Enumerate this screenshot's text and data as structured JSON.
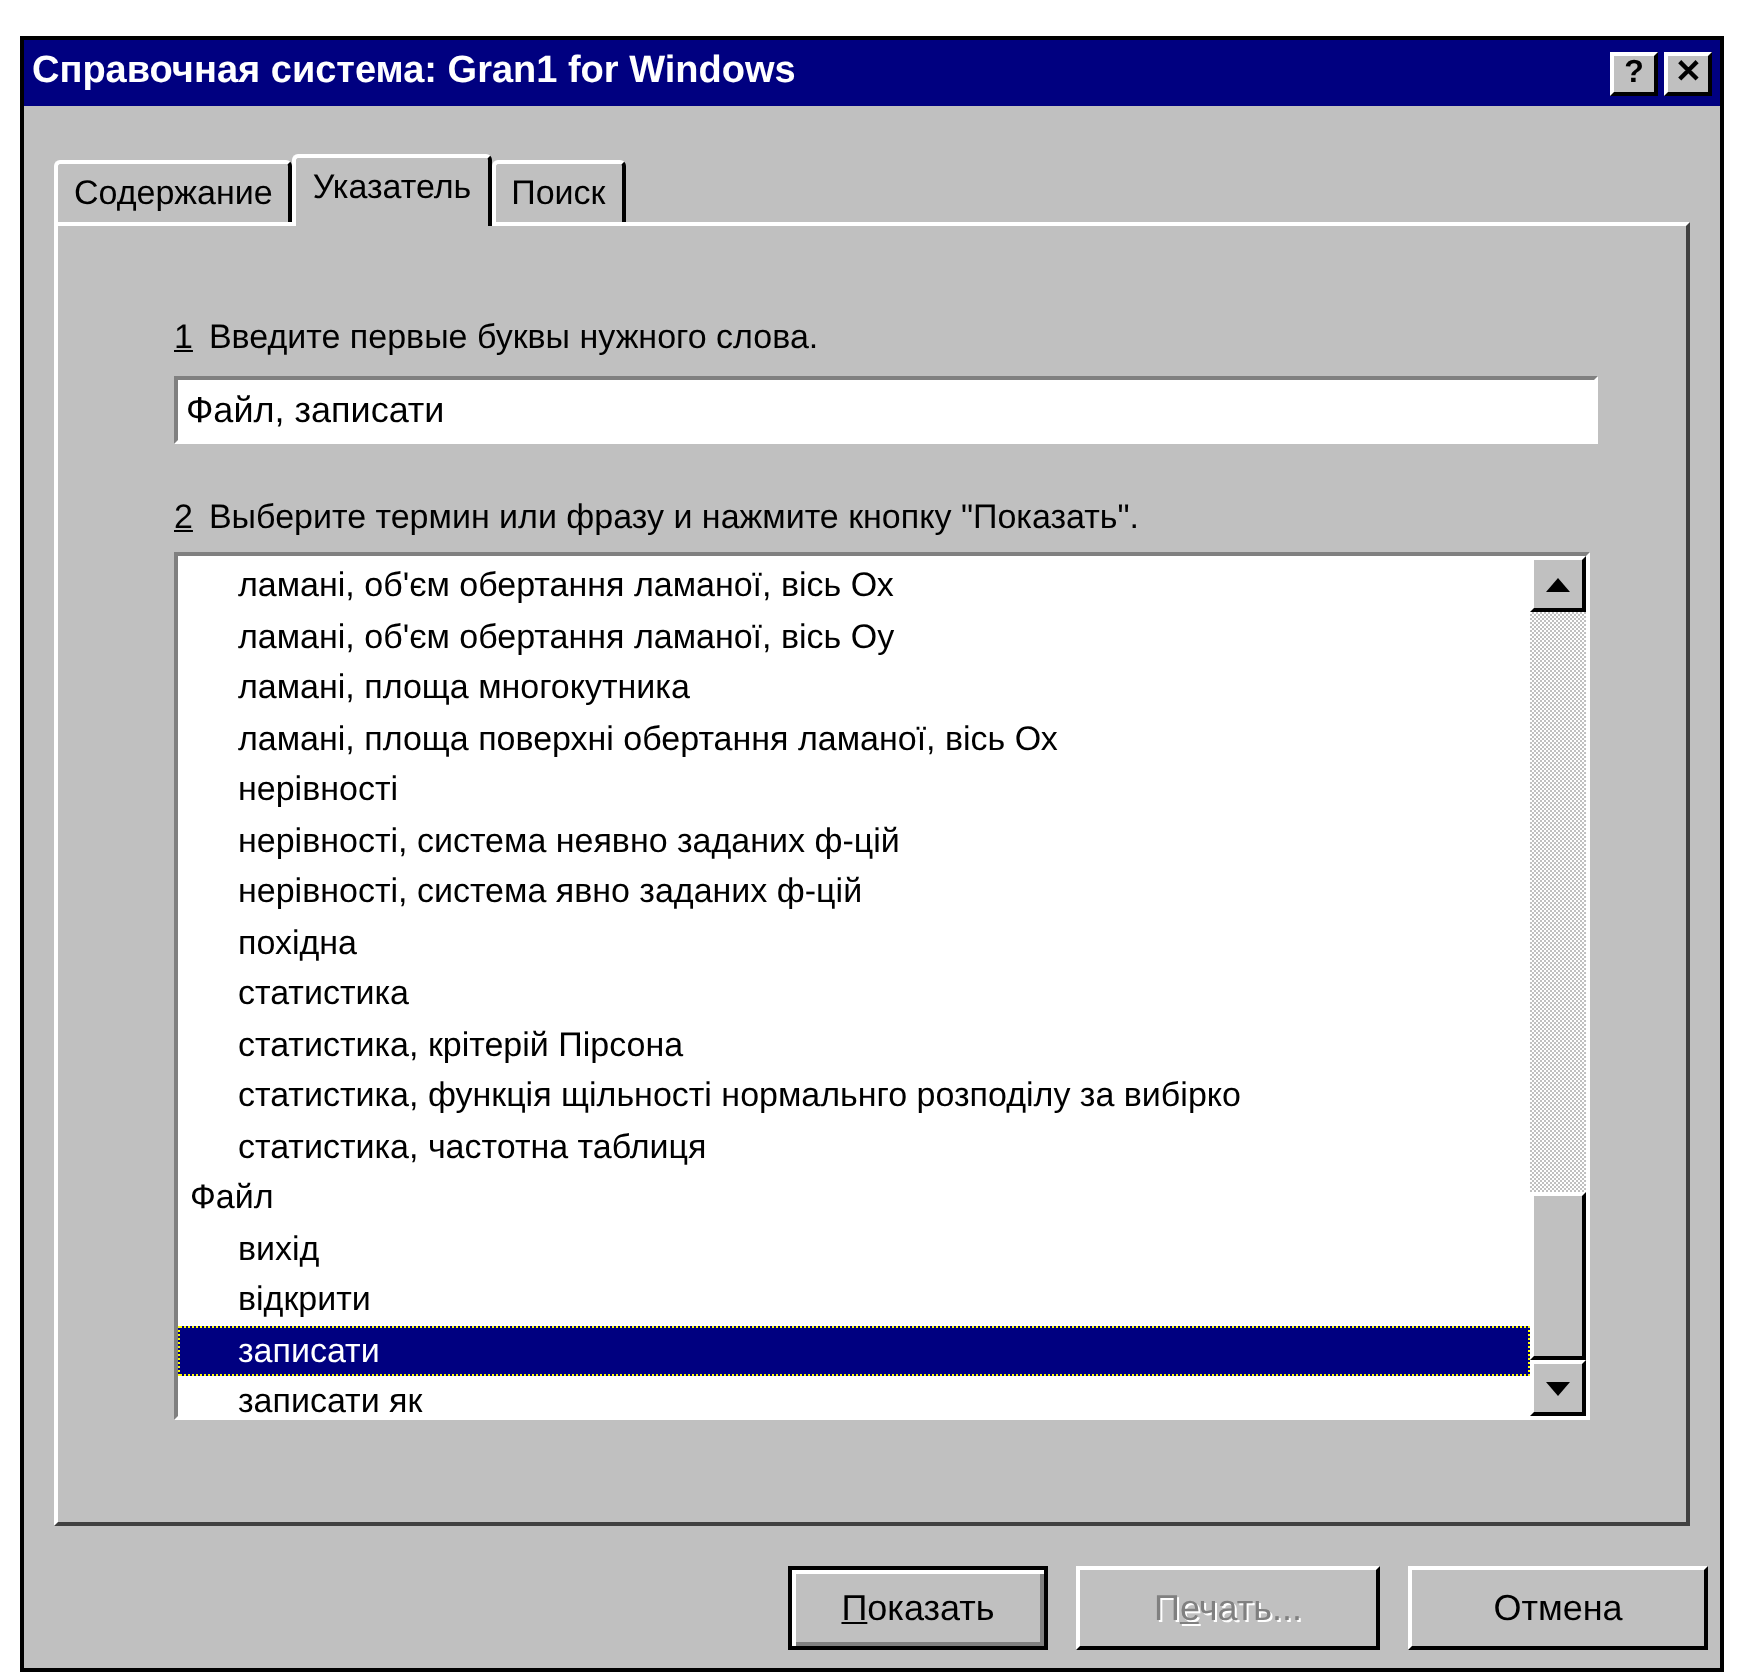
{
  "window": {
    "title": "Справочная система: Gran1 for Windows",
    "title_buttons": [
      "?",
      "✕"
    ]
  },
  "tabs": [
    {
      "label": "Содержание",
      "selected": false
    },
    {
      "label": "Указатель",
      "selected": true
    },
    {
      "label": "Поиск",
      "selected": false
    }
  ],
  "step_1": {
    "number": "1",
    "text": "Введите первые буквы нужного слова."
  },
  "search": {
    "value": "Файл, записати"
  },
  "step_2": {
    "number": "2",
    "text": "Выберите термин или фразу и нажмите кнопку \"Показать\"."
  },
  "index_list": {
    "entries": [
      {
        "children": [
          {
            "text": "ламані, об'єм обертання ламаної, вісь Ох",
            "selected": false
          },
          {
            "text": "ламані, об'єм обертання ламаної, вісь Оу",
            "selected": false
          },
          {
            "text": "ламані, площа многокутника",
            "selected": false
          },
          {
            "text": "ламані, площа поверхні обертання ламаної, вісь Ох",
            "selected": false
          },
          {
            "text": "нерівності",
            "selected": false
          },
          {
            "text": "нерівності, система неявно заданих ф-цій",
            "selected": false
          },
          {
            "text": "нерівності, система явно заданих ф-цій",
            "selected": false
          },
          {
            "text": "похідна",
            "selected": false
          },
          {
            "text": "статистика",
            "selected": false
          },
          {
            "text": "статистика, крітерій Пірсона",
            "selected": false
          },
          {
            "text": "статистика, функція щільності нормальнго розподілу за вибірко",
            "selected": false
          },
          {
            "text": "статистика, частотна таблиця",
            "selected": false
          }
        ]
      },
      {
        "text": "Файл",
        "selected": false,
        "children": [
          {
            "text": "вихід",
            "selected": false
          },
          {
            "text": "відкрити",
            "selected": false
          },
          {
            "text": "записати",
            "selected": true
          },
          {
            "text": "записати як",
            "selected": false
          }
        ]
      }
    ]
  },
  "buttons": [
    {
      "accel": "П",
      "after": "оказать",
      "default": true,
      "disabled": false
    },
    {
      "before": "П",
      "accel": "е",
      "after": "чать...",
      "default": false,
      "disabled": true
    },
    {
      "after": "Отмена",
      "default": false,
      "disabled": false
    }
  ]
}
